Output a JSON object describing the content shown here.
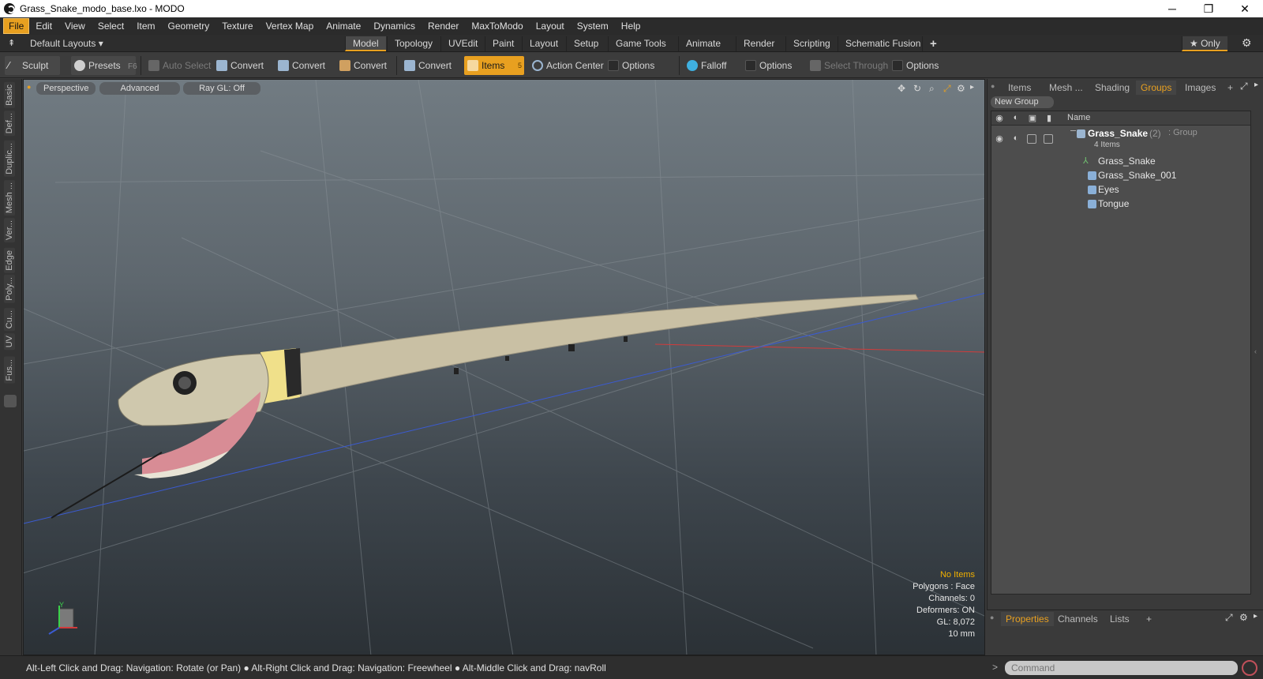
{
  "window": {
    "title": "Grass_Snake_modo_base.lxo - MODO",
    "minimize": "─",
    "restore": "❐",
    "close": "✕"
  },
  "menu": [
    "File",
    "Edit",
    "View",
    "Select",
    "Item",
    "Geometry",
    "Texture",
    "Vertex Map",
    "Animate",
    "Dynamics",
    "Render",
    "MaxToModo",
    "Layout",
    "System",
    "Help"
  ],
  "layoutbar": {
    "layouts_label": "Default Layouts ▾",
    "tabs": [
      "Model",
      "Topology",
      "UVEdit",
      "Paint",
      "Layout",
      "Setup",
      "Game Tools",
      "Animate",
      "Render",
      "Scripting",
      "Schematic Fusion"
    ],
    "active_tab": "Model",
    "add": "+",
    "only": "★ Only",
    "gear": "⚙"
  },
  "toolbar": {
    "sculpt": "Sculpt",
    "presets": "Presets",
    "presets_key": "F6",
    "auto_select": "Auto Select",
    "convert1": "Convert",
    "convert2": "Convert",
    "convert3": "Convert",
    "convert4": "Convert",
    "items": "Items",
    "items_key": "5",
    "action_center": "Action Center",
    "options1": "Options",
    "falloff": "Falloff",
    "options2": "Options",
    "select_through": "Select Through",
    "options3": "Options"
  },
  "lefttabs": [
    "Basic",
    "Def...",
    "Duplic...",
    "Mesh ...",
    "Ver...",
    "Edge",
    "Poly...",
    "Cu...",
    "UV",
    "Fus..."
  ],
  "viewport": {
    "tabs": {
      "perspective": "Perspective",
      "advanced": "Advanced",
      "raygl": "Ray GL: Off"
    },
    "hud": {
      "items": "No Items",
      "polygons": "Polygons : Face",
      "channels": "Channels: 0",
      "deformers": "Deformers: ON",
      "gl": "GL: 8,072",
      "scale": "10 mm"
    },
    "axis_y": "Y",
    "colors": {
      "items_hud": "#f0b000",
      "axis_x": "#d23b3b",
      "axis_z": "#3b5bd2",
      "axis_y": "#3bd24a"
    }
  },
  "rightpanel": {
    "tabs": [
      "Items",
      "Mesh ...",
      "Shading",
      "Groups",
      "Images"
    ],
    "active_tab": "Groups",
    "add": "+",
    "new_group": "New Group",
    "col_name": "Name",
    "group": {
      "name": "Grass_Snake",
      "count": "(2)",
      "type": ": Group",
      "subtitle": "4 Items"
    },
    "children": [
      "Grass_Snake",
      "Grass_Snake_001",
      "Eyes",
      "Tongue"
    ]
  },
  "bottompanel": {
    "tabs": [
      "Properties",
      "Channels",
      "Lists"
    ],
    "active_tab": "Properties",
    "add": "+"
  },
  "status": {
    "text": "Alt-Left Click and Drag: Navigation: Rotate (or Pan) ● Alt-Right Click and Drag: Navigation: Freewheel ● Alt-Middle Click and Drag: navRoll",
    "prompt": ">",
    "command_placeholder": "Command"
  },
  "accent": "#e8a020"
}
